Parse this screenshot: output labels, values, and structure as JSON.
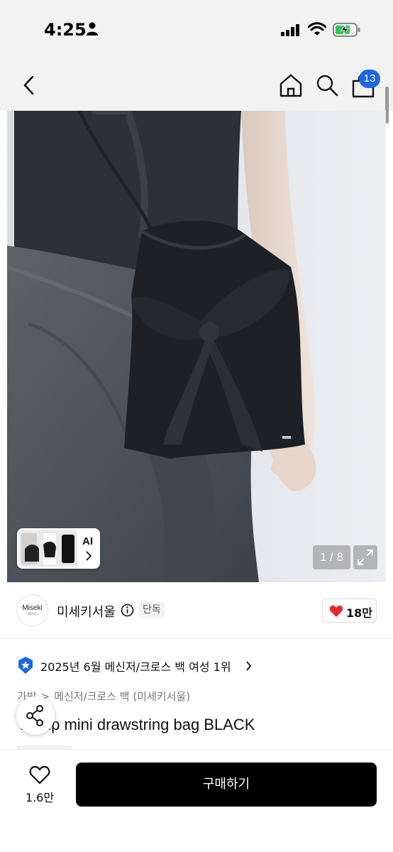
{
  "status_bar": {
    "time": "4:25",
    "icons": [
      "person-icon",
      "cellular-signal-icon",
      "wifi-icon",
      "battery-charging-icon"
    ]
  },
  "nav": {
    "icons": [
      "back-chevron-icon",
      "home-icon",
      "search-icon",
      "shopping-bag-icon"
    ],
    "cart_count": "13",
    "badge_color": "#1c66e6"
  },
  "gallery": {
    "ai_label": "AI",
    "page_counter": "1 / 8",
    "current_page": 1,
    "total_pages": 8
  },
  "shop": {
    "logo_text": "Miseki",
    "logo_subtext": "SEOUL",
    "name": "미세키서울",
    "exclusive_badge": "단독",
    "like_count": "18만",
    "heart_color": "#e8262c"
  },
  "ranking": {
    "text": "2025년 6월 메신저/크로스 백 여성 1위"
  },
  "breadcrumb": {
    "items": [
      "가방",
      "메신저/크로스 백",
      "(미세키서울)"
    ],
    "separator": ">"
  },
  "product": {
    "title": "Tie up mini drawstring bag BLACK"
  },
  "bottom_bar": {
    "wish_count": "1.6만",
    "buy_label": "구매하기"
  }
}
